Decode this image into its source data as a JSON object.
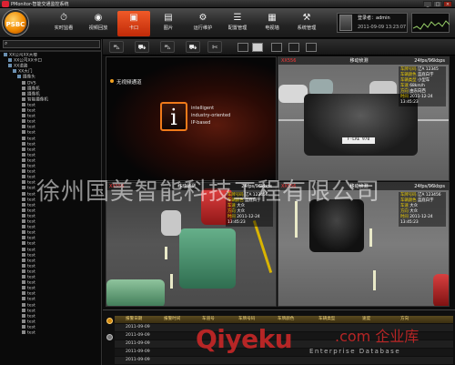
{
  "app": {
    "title": "PMonitor-智能交通监控系统",
    "logo_text": "PSBC"
  },
  "window_controls": [
    "_",
    "□",
    "×"
  ],
  "nav": {
    "items": [
      {
        "label": "实时监看",
        "icon": "⏱"
      },
      {
        "label": "视频回放",
        "icon": "◉"
      },
      {
        "label": "卡口",
        "icon": "▣"
      },
      {
        "label": "图片",
        "icon": "▤"
      },
      {
        "label": "运行维护",
        "icon": "⚙"
      },
      {
        "label": "配置管理",
        "icon": "☰"
      },
      {
        "label": "电视墙",
        "icon": "▦"
      },
      {
        "label": "系统管理",
        "icon": "⚒"
      }
    ]
  },
  "user": {
    "login_label": "登录者：admin",
    "clock": "2011-09-09   13:23:07"
  },
  "tree": {
    "items": [
      {
        "label": "XX公司XX大楼",
        "indent": 0,
        "kind": "group"
      },
      {
        "label": "XX公司XX卡口",
        "indent": 1,
        "kind": "group"
      },
      {
        "label": "XX道路",
        "indent": 1,
        "kind": "group"
      },
      {
        "label": "XX大门",
        "indent": 2,
        "kind": "group"
      },
      {
        "label": "摄像头",
        "indent": 3,
        "kind": "group"
      },
      {
        "label": "DVS",
        "indent": 4,
        "kind": "cam"
      },
      {
        "label": "摄像机",
        "indent": 4,
        "kind": "cam"
      },
      {
        "label": "摄像机",
        "indent": 4,
        "kind": "cam"
      },
      {
        "label": "智能摄像机",
        "indent": 4,
        "kind": "cam"
      },
      {
        "label": "test",
        "indent": 4,
        "kind": "cam"
      },
      {
        "label": "test",
        "indent": 4,
        "kind": "cam"
      },
      {
        "label": "test",
        "indent": 4,
        "kind": "cam"
      },
      {
        "label": "test",
        "indent": 4,
        "kind": "cam"
      },
      {
        "label": "test",
        "indent": 4,
        "kind": "cam"
      },
      {
        "label": "test",
        "indent": 4,
        "kind": "cam"
      },
      {
        "label": "test",
        "indent": 4,
        "kind": "cam"
      },
      {
        "label": "test",
        "indent": 4,
        "kind": "cam"
      },
      {
        "label": "test",
        "indent": 4,
        "kind": "cam"
      },
      {
        "label": "test",
        "indent": 4,
        "kind": "cam"
      },
      {
        "label": "test",
        "indent": 4,
        "kind": "cam"
      },
      {
        "label": "test",
        "indent": 4,
        "kind": "cam"
      },
      {
        "label": "test",
        "indent": 4,
        "kind": "cam"
      },
      {
        "label": "test",
        "indent": 4,
        "kind": "cam"
      },
      {
        "label": "test",
        "indent": 4,
        "kind": "cam"
      },
      {
        "label": "test",
        "indent": 4,
        "kind": "cam"
      },
      {
        "label": "test",
        "indent": 4,
        "kind": "cam"
      },
      {
        "label": "test",
        "indent": 4,
        "kind": "cam"
      },
      {
        "label": "test",
        "indent": 4,
        "kind": "cam"
      },
      {
        "label": "test",
        "indent": 4,
        "kind": "cam"
      },
      {
        "label": "test",
        "indent": 4,
        "kind": "cam"
      },
      {
        "label": "test",
        "indent": 4,
        "kind": "cam"
      },
      {
        "label": "test",
        "indent": 4,
        "kind": "cam"
      },
      {
        "label": "test",
        "indent": 4,
        "kind": "cam"
      },
      {
        "label": "test",
        "indent": 4,
        "kind": "cam"
      },
      {
        "label": "test",
        "indent": 4,
        "kind": "cam"
      },
      {
        "label": "test",
        "indent": 4,
        "kind": "cam"
      },
      {
        "label": "test",
        "indent": 4,
        "kind": "cam"
      },
      {
        "label": "test",
        "indent": 4,
        "kind": "cam"
      },
      {
        "label": "test",
        "indent": 4,
        "kind": "cam"
      },
      {
        "label": "test",
        "indent": 4,
        "kind": "cam"
      },
      {
        "label": "test",
        "indent": 4,
        "kind": "cam"
      },
      {
        "label": "test",
        "indent": 4,
        "kind": "cam"
      },
      {
        "label": "test",
        "indent": 4,
        "kind": "cam"
      },
      {
        "label": "test",
        "indent": 4,
        "kind": "cam"
      },
      {
        "label": "test",
        "indent": 4,
        "kind": "cam"
      },
      {
        "label": "test",
        "indent": 4,
        "kind": "cam"
      },
      {
        "label": "test",
        "indent": 4,
        "kind": "cam"
      },
      {
        "label": "test",
        "indent": 4,
        "kind": "cam"
      },
      {
        "label": "test",
        "indent": 4,
        "kind": "cam"
      },
      {
        "label": "test",
        "indent": 4,
        "kind": "cam"
      },
      {
        "label": "test",
        "indent": 4,
        "kind": "cam"
      }
    ]
  },
  "view_tools": [
    "⛍",
    "⛟",
    "⛍",
    "⛟",
    "✄",
    "✕"
  ],
  "no_signal": {
    "label": "无视频通道",
    "brand_lines": [
      "intelligent",
      "industry-oriented",
      "IP-based"
    ],
    "brand_logo": "i"
  },
  "cameras": [
    {
      "id": "XX556",
      "title": "移动侦测",
      "rate": "24fps/96kbps",
      "plate": "F-LAE 970",
      "info": [
        [
          "车牌号码",
          "辽A 12345"
        ],
        [
          "车辆颜色",
          "蓝底白字"
        ],
        [
          "车辆类型",
          "小型车"
        ],
        [
          "车速",
          "68km/h"
        ],
        [
          "方向",
          "由东向西"
        ],
        [
          "时间",
          "2011-12-24"
        ],
        [
          "",
          "13:45:23"
        ]
      ]
    },
    {
      "id": "XX556",
      "title": "移动侦测",
      "rate": "24fps/96kbps",
      "info": [
        [
          "车牌号码",
          "辽A 123456"
        ],
        [
          "车辆颜色",
          "蓝底白字"
        ],
        [
          "车速",
          "大众"
        ],
        [
          "方向",
          "大众"
        ],
        [
          "时间",
          "2011-12-24"
        ],
        [
          "",
          "13:45:23"
        ]
      ]
    },
    {
      "id": "XX556",
      "title": "移动侦测",
      "rate": "24fps/96kbps",
      "info": [
        [
          "车牌号码",
          "辽A 123456"
        ],
        [
          "车辆颜色",
          "蓝底白字"
        ],
        [
          "车速",
          "大众"
        ],
        [
          "方向",
          "大众"
        ],
        [
          "时间",
          "2011-12-24"
        ],
        [
          "",
          "13:45:23"
        ]
      ]
    }
  ],
  "watermark": "徐州国美智能科技工程有限公司",
  "records": {
    "columns": [
      "报警日期",
      "报警时间",
      "车道号",
      "车牌号码",
      "车牌颜色",
      "车辆类型",
      "速度",
      "方向"
    ],
    "rows": [
      [
        "2011-09-09",
        "",
        "",
        "",
        "",
        "",
        "",
        ""
      ],
      [
        "2011-09-09",
        "",
        "",
        "",
        "",
        "",
        "",
        ""
      ],
      [
        "2011-09-09",
        "",
        "",
        "",
        "",
        "",
        "",
        ""
      ],
      [
        "2011-09-09",
        "",
        "",
        "",
        "",
        "",
        "",
        ""
      ],
      [
        "2011-09-09",
        "",
        "",
        "",
        "",
        "",
        "",
        ""
      ]
    ]
  },
  "overlay_brand": {
    "logo": "Qiyeku",
    "cn": ".com 企业库",
    "sub": "Enterprise Database"
  },
  "colors": {
    "accent": "#e0461a",
    "osd_yellow": "#f0d000",
    "alert_red": "#ff3a3a"
  }
}
